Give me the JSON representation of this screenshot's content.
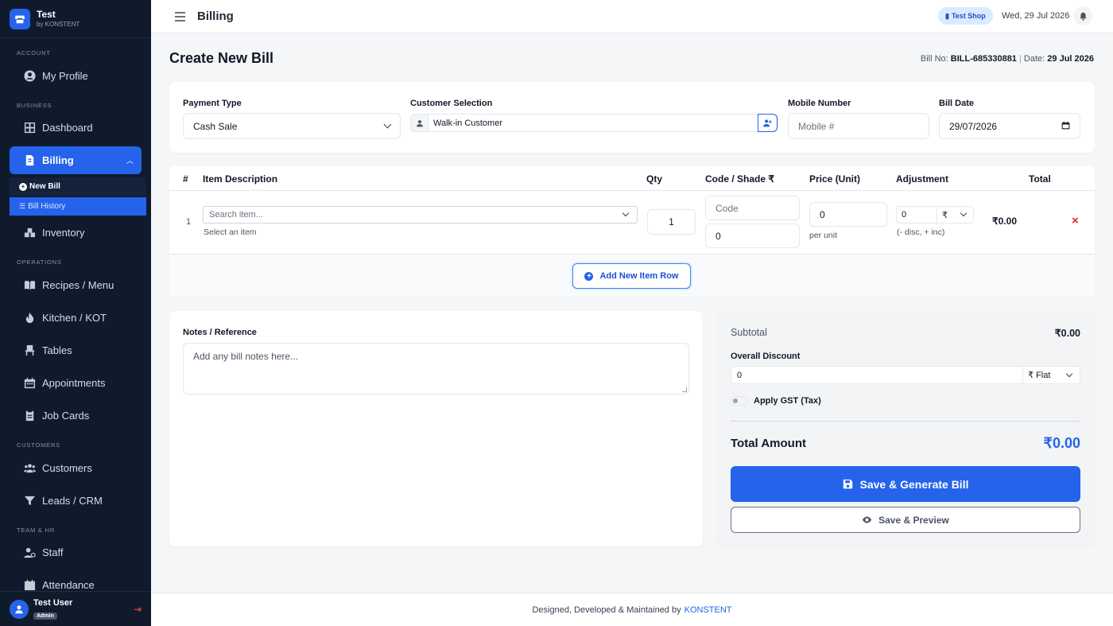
{
  "brand": {
    "name": "Test",
    "sub": "by KONSTENT"
  },
  "sidebar": {
    "sections": {
      "account": "ACCOUNT",
      "business": "BUSINESS",
      "operations": "OPERATIONS",
      "customers": "CUSTOMERS",
      "team": "TEAM & HR"
    },
    "items": {
      "profile": "My Profile",
      "dashboard": "Dashboard",
      "billing": "Billing",
      "new_bill": "New Bill",
      "bill_history": "Bill History",
      "inventory": "Inventory",
      "recipes": "Recipes / Menu",
      "kitchen": "Kitchen / KOT",
      "tables": "Tables",
      "appointments": "Appointments",
      "job_cards": "Job Cards",
      "customers": "Customers",
      "leads": "Leads / CRM",
      "staff": "Staff",
      "attendance": "Attendance"
    },
    "user": {
      "name": "Test User",
      "role": "Admin"
    }
  },
  "header": {
    "title": "Billing",
    "shop": "Test Shop",
    "date": "Wed, 29 Jul 2026"
  },
  "page": {
    "title": "Create New Bill",
    "bill_no_label": "Bill No:",
    "bill_no": "BILL-685330881",
    "date_label": "Date:",
    "date": "29 Jul 2026"
  },
  "form": {
    "payment_type_label": "Payment Type",
    "payment_type": "Cash Sale",
    "customer_label": "Customer Selection",
    "customer": "Walk-in Customer",
    "mobile_label": "Mobile Number",
    "mobile_placeholder": "Mobile #",
    "bill_date_label": "Bill Date",
    "bill_date": "29/07/2026"
  },
  "table": {
    "headers": {
      "num": "#",
      "desc": "Item Description",
      "qty": "Qty",
      "code": "Code / Shade ₹",
      "price": "Price (Unit)",
      "adj": "Adjustment",
      "total": "Total"
    },
    "row": {
      "num": "1",
      "search_placeholder": "Search item...",
      "hint": "Select an item",
      "qty": "1",
      "code_placeholder": "Code",
      "shade": "0",
      "price": "0",
      "per_unit": "per unit",
      "adj": "0",
      "adj_unit": "₹",
      "adj_hint": "(- disc, + inc)",
      "total": "₹0.00",
      "delete": "×"
    },
    "add_row": "Add New Item Row"
  },
  "notes": {
    "label": "Notes / Reference",
    "placeholder": "Add any bill notes here..."
  },
  "summary": {
    "subtotal_label": "Subtotal",
    "subtotal": "₹0.00",
    "discount_label": "Overall Discount",
    "discount": "0",
    "discount_type": "₹ Flat",
    "gst_label": "Apply GST (Tax)",
    "gst_enabled": false,
    "total_label": "Total Amount",
    "total": "₹0.00",
    "save_generate": "Save & Generate Bill",
    "save_preview": "Save & Preview"
  },
  "footer": {
    "text": "Designed, Developed & Maintained by",
    "link": "KONSTENT"
  },
  "colors": {
    "primary": "#2563eb",
    "sidebar": "#0f1b2d",
    "danger": "#dc2626"
  }
}
